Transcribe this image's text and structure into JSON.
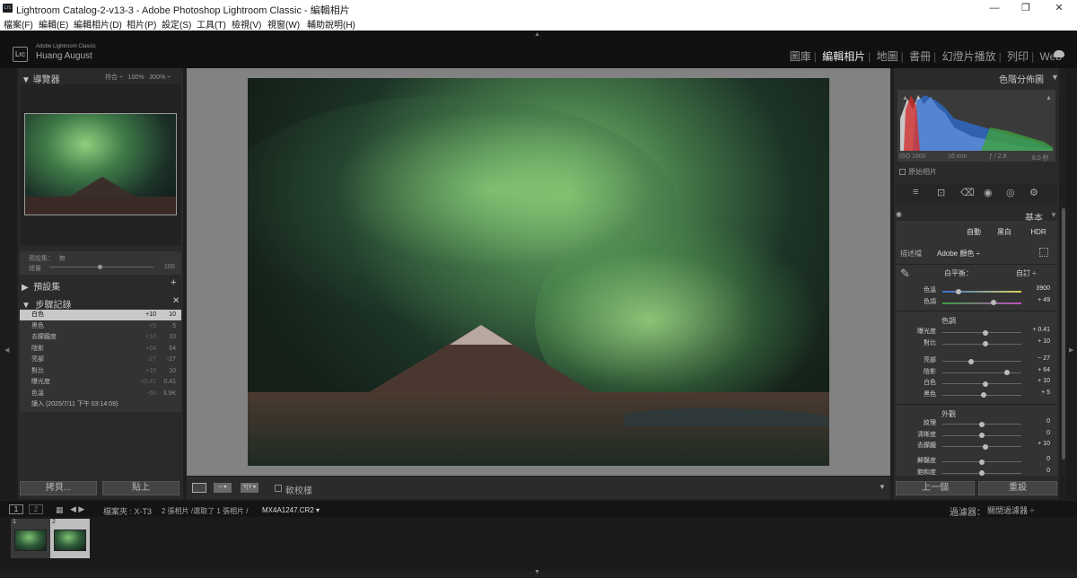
{
  "window": {
    "title": "Lightroom Catalog-2-v13-3 - Adobe Photoshop Lightroom Classic - 編輯相片",
    "app_icon": "Lrc",
    "controls": {
      "minimize": "—",
      "maximize": "❐",
      "close": "✕"
    }
  },
  "menu": [
    "檔案(F)",
    "編輯(E)",
    "編輯相片(D)",
    "相片(P)",
    "設定(S)",
    "工具(T)",
    "檢視(V)",
    "視窗(W)",
    "輔助說明(H)"
  ],
  "identity": {
    "logo": "Lrc",
    "product": "Adobe Lightroom Classic",
    "user": "Huang August"
  },
  "modules": {
    "items": [
      "圖庫",
      "編輯相片",
      "地圖",
      "書冊",
      "幻燈片播放",
      "列印",
      "Web"
    ],
    "active": "編輯相片",
    "separator": "|"
  },
  "navigator": {
    "title": "導覽器",
    "expand_icon": "▼",
    "options": [
      "符合 ÷",
      "100%",
      "300% ÷"
    ]
  },
  "preset_amount": {
    "preset_label": "預設集：",
    "preset_value": "無",
    "amount_label": "總量",
    "amount_value": "100",
    "amount_fraction": 0.5
  },
  "presets": {
    "title": "預設集",
    "collapse_icon": "▶",
    "add_icon": "+"
  },
  "history": {
    "title": "步驟記錄",
    "expand_icon": "▼",
    "close_icon": "✕",
    "rows": [
      {
        "name": "白色",
        "adj": "+10",
        "value": "10",
        "selected": true
      },
      {
        "name": "黑色",
        "adj": "+5",
        "value": "5"
      },
      {
        "name": "去朦朧度",
        "adj": "+10",
        "value": "10"
      },
      {
        "name": "陰影",
        "adj": "+64",
        "value": "64"
      },
      {
        "name": "亮部",
        "adj": "-27",
        "value": "-27"
      },
      {
        "name": "對比",
        "adj": "+10",
        "value": "10"
      },
      {
        "name": "曝光度",
        "adj": "+0.41",
        "value": "0.41"
      },
      {
        "name": "色溫",
        "adj": "-50",
        "value": "3.9K"
      },
      {
        "name": "讀入 (2025/7/11 下午 03:14:09)",
        "adj": "",
        "value": ""
      }
    ]
  },
  "left_buttons": {
    "copy": "拷貝...",
    "paste": "貼上"
  },
  "toolbar": {
    "softproof": "軟校樣",
    "view2": "▫▫ ▾",
    "view3": "Y|Y ▾",
    "dropdown": "▼"
  },
  "histogram": {
    "title": "色階分佈圖",
    "expand_icon": "▼",
    "iso": "ISO 1600",
    "focal": "16 mm",
    "aperture": "ƒ / 2.8",
    "shutter": "8.0 秒",
    "original_label": "原始相片",
    "clip_icon": "▲"
  },
  "tools": [
    "≡",
    "⊡",
    "⌫",
    "◉",
    "◎",
    "⚙"
  ],
  "basic": {
    "title": "基本",
    "expand_icon": "▼",
    "eye_icon": "◉",
    "treatment_buttons": [
      "自動",
      "黑白",
      "HDR"
    ],
    "profile_label": "描述檔",
    "profile_value": "Adobe 顏色 ÷",
    "wb_label": "白平衡：",
    "wb_value": "自訂 ÷",
    "wb_sliders": [
      {
        "label": "色溫",
        "value": "3900",
        "pos": 0.2
      },
      {
        "label": "色調",
        "value": "+ 49",
        "pos": 0.65
      }
    ],
    "tone_title": "色調",
    "tone_sliders": [
      {
        "label": "曝光度",
        "value": "+ 0.41",
        "pos": 0.54
      },
      {
        "label": "對比",
        "value": "+ 10",
        "pos": 0.55
      }
    ],
    "tone_sliders2": [
      {
        "label": "亮部",
        "value": "− 27",
        "pos": 0.36
      },
      {
        "label": "陰影",
        "value": "+ 64",
        "pos": 0.82
      },
      {
        "label": "白色",
        "value": "+ 10",
        "pos": 0.55
      },
      {
        "label": "黑色",
        "value": "+ 5",
        "pos": 0.52
      }
    ],
    "presence_title": "外觀",
    "presence_sliders": [
      {
        "label": "紋理",
        "value": "0",
        "pos": 0.5
      },
      {
        "label": "清晰度",
        "value": "0",
        "pos": 0.5
      },
      {
        "label": "去朦朧",
        "value": "+ 10",
        "pos": 0.55
      }
    ],
    "presence_sliders2": [
      {
        "label": "鮮豔度",
        "value": "0",
        "pos": 0.5
      },
      {
        "label": "飽和度",
        "value": "0",
        "pos": 0.5
      }
    ]
  },
  "right_buttons": {
    "prev": "上一個",
    "reset": "重設"
  },
  "filmstrip": {
    "view1": "1",
    "view2": "2",
    "grid_icon": "▦",
    "nav": "◀ ▶",
    "source": "檔案夾 : X-T3",
    "count": "2 張相片 /選取了 1 張相片 /",
    "filename": "MX4A1247.CR2 ▾",
    "filter_label": "過濾器：",
    "filter_value": "關閉過濾器 ÷",
    "cells": [
      {
        "num": "1"
      },
      {
        "num": "2"
      }
    ]
  },
  "arrows": {
    "top": "▲",
    "bottom": "▼",
    "left": "◀",
    "right": "▶"
  }
}
